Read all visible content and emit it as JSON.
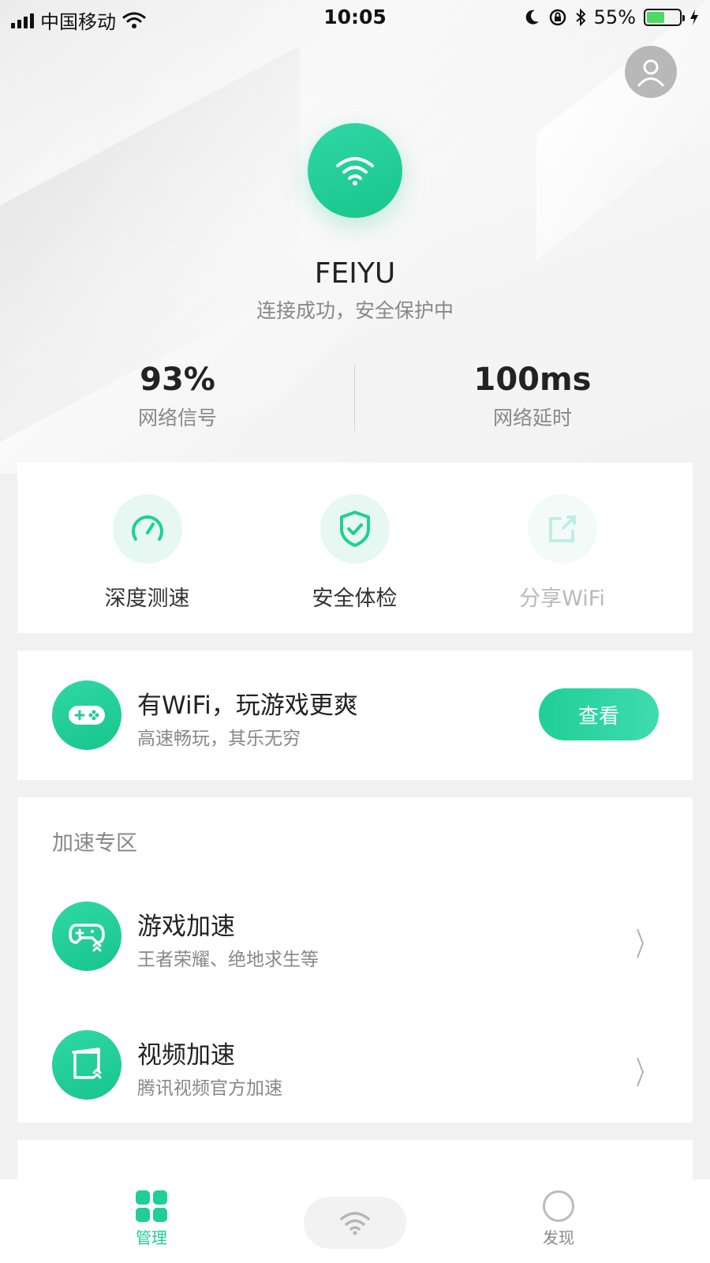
{
  "status_bar": {
    "carrier": "中国移动",
    "time": "10:05",
    "battery_percent": "55%",
    "battery_level": 0.55
  },
  "hero": {
    "ssid": "FEIYU",
    "status": "连接成功，安全保护中"
  },
  "stats": [
    {
      "value": "93%",
      "label": "网络信号"
    },
    {
      "value": "100ms",
      "label": "网络延时"
    }
  ],
  "tools": [
    {
      "label": "深度测速",
      "icon": "speedometer-icon"
    },
    {
      "label": "安全体检",
      "icon": "shield-check-icon"
    },
    {
      "label": "分享WiFi",
      "icon": "share-icon"
    }
  ],
  "promo": {
    "title": "有WiFi，玩游戏更爽",
    "subtitle": "高速畅玩，其乐无穷",
    "button": "查看",
    "icon": "gamepad-icon"
  },
  "accel": {
    "section_title": "加速专区",
    "items": [
      {
        "name": "游戏加速",
        "desc": "王者荣耀、绝地求生等",
        "icon": "game-boost-icon"
      },
      {
        "name": "视频加速",
        "desc": "腾讯视频官方加速",
        "icon": "video-boost-icon"
      }
    ]
  },
  "tab_bar": {
    "tabs": [
      {
        "label": "管理",
        "icon": "grid-icon",
        "active": true
      },
      {
        "label": "",
        "icon": "wifi-icon",
        "active": false
      },
      {
        "label": "发现",
        "icon": "discover-icon",
        "active": false
      }
    ]
  },
  "colors": {
    "accent": "#1fcf96",
    "accent_light": "#e6f8f1",
    "background": "#f1f1f1"
  }
}
